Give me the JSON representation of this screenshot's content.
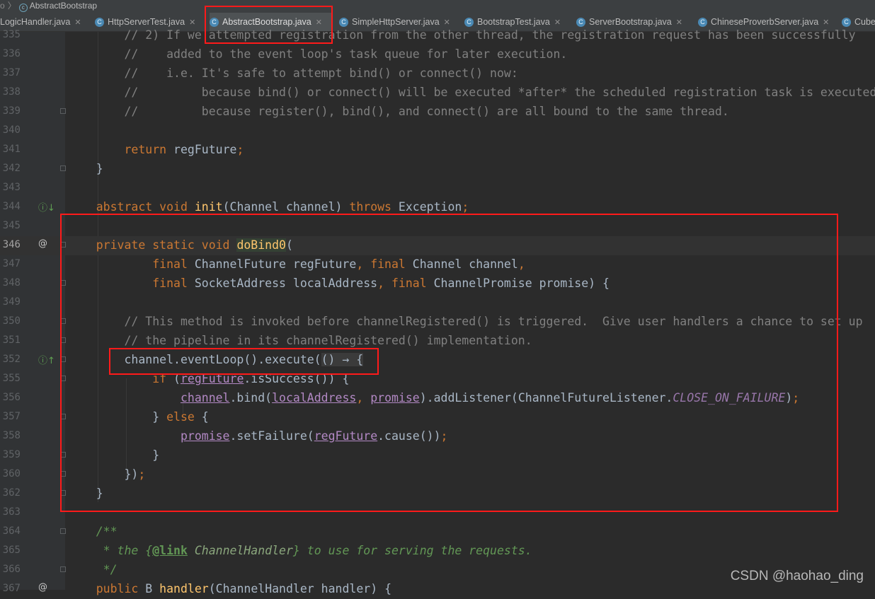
{
  "breadcrumb": {
    "prefix": "o",
    "file": "AbstractBootstrap"
  },
  "tabs": [
    {
      "label": "LogicHandler.java",
      "active": false
    },
    {
      "label": "HttpServerTest.java",
      "active": false
    },
    {
      "label": "AbstractBootstrap.java",
      "active": true
    },
    {
      "label": "SimpleHttpServer.java",
      "active": false
    },
    {
      "label": "BootstrapTest.java",
      "active": false
    },
    {
      "label": "ServerBootstrap.java",
      "active": false
    },
    {
      "label": "ChineseProverbServer.java",
      "active": false
    },
    {
      "label": "Cube",
      "active": false
    }
  ],
  "code_lines": [
    {
      "num": "335",
      "html": "        <span class=\"cm\">// 2) If we attempted registration from the other thread, the registration request has been successfully</span>"
    },
    {
      "num": "336",
      "html": "        <span class=\"cm\">//    added to the event loop's task queue for later execution.</span>"
    },
    {
      "num": "337",
      "html": "        <span class=\"cm\">//    i.e. It's safe to attempt bind() or connect() now:</span>"
    },
    {
      "num": "338",
      "html": "        <span class=\"cm\">//         because bind() or connect() will be executed *after* the scheduled registration task is executed</span>"
    },
    {
      "num": "339",
      "html": "        <span class=\"cm\">//         because register(), bind(), and connect() are all bound to the same thread.</span>",
      "fold": true
    },
    {
      "num": "340",
      "html": ""
    },
    {
      "num": "341",
      "html": "        <span class=\"kw\">return</span> regFuture<span class=\"kw\">;</span>"
    },
    {
      "num": "342",
      "html": "    }",
      "fold": true
    },
    {
      "num": "343",
      "html": ""
    },
    {
      "num": "344",
      "html": "    <span class=\"kw\">abstract void</span> <span class=\"fn\">init</span>(Channel channel) <span class=\"kw\">throws</span> Exception<span class=\"kw\">;</span>",
      "gutter_icon": "ⓘ↓",
      "gutter_icon_name": "implemented-down-icon"
    },
    {
      "num": "345",
      "html": ""
    },
    {
      "num": "346",
      "html": "    <span class=\"kw\">private static void</span> <span class=\"fn-hl\">doBind0</span>(",
      "gutter_icon": "@",
      "gutter_icon_name": "annotation-icon",
      "current": true,
      "fold": true
    },
    {
      "num": "347",
      "html": "            <span class=\"kw\">final</span> ChannelFuture regFuture<span class=\"kw\">,</span> <span class=\"kw\">final</span> Channel channel<span class=\"kw\">,</span>"
    },
    {
      "num": "348",
      "html": "            <span class=\"kw\">final</span> SocketAddress localAddress<span class=\"kw\">,</span> <span class=\"kw\">final</span> ChannelPromise promise) {",
      "fold": true
    },
    {
      "num": "349",
      "html": ""
    },
    {
      "num": "350",
      "html": "        <span class=\"cm\">// This method is invoked before channelRegistered() is triggered.  Give user handlers a chance to set up</span>",
      "fold": true
    },
    {
      "num": "351",
      "html": "        <span class=\"cm\">// the pipeline in its channelRegistered() implementation.</span>",
      "fold": true
    },
    {
      "num": "352",
      "html": "        channel.eventLoop().execute(<span class=\"fold-hint\">() → {</span>",
      "gutter_icon": "ⓘ↑",
      "gutter_icon_name": "implements-up-icon",
      "fold": true
    },
    {
      "num": "355",
      "html": "            <span class=\"kw\">if</span> (<span class=\"capt\">regFuture</span>.isSuccess()) {",
      "fold": true
    },
    {
      "num": "356",
      "html": "                <span class=\"capt\">channel</span>.bind(<span class=\"capt\">localAddress</span><span class=\"kw\">,</span> <span class=\"capt\">promise</span>).addListener(ChannelFutureListener.<span class=\"const\">CLOSE_ON_FAILURE</span>)<span class=\"kw\">;</span>"
    },
    {
      "num": "357",
      "html": "            } <span class=\"kw\">else</span> {",
      "fold": true
    },
    {
      "num": "358",
      "html": "                <span class=\"capt\">promise</span>.setFailure(<span class=\"capt\">regFuture</span>.cause())<span class=\"kw\">;</span>"
    },
    {
      "num": "359",
      "html": "            }",
      "fold": true
    },
    {
      "num": "360",
      "html": "        })<span class=\"kw\">;</span>",
      "fold": true
    },
    {
      "num": "362",
      "html": "    }",
      "fold": true
    },
    {
      "num": "363",
      "html": ""
    },
    {
      "num": "364",
      "html": "    <span class=\"doc\">/**</span>",
      "fold": true
    },
    {
      "num": "365",
      "html": "     <span class=\"doc\">* the {</span><span class=\"doc-tag\">@link</span> <span class=\"doc-ref\">ChannelHandler</span><span class=\"doc\">} to use for serving the requests.</span>"
    },
    {
      "num": "366",
      "html": "     <span class=\"doc\">*/</span>",
      "fold": true
    },
    {
      "num": "367",
      "html": "    <span class=\"kw\">public</span> B <span class=\"fn\">handler</span>(ChannelHandler handler) {",
      "gutter_icon": "@",
      "gutter_icon_name": "annotation-icon"
    }
  ],
  "watermark": "CSDN @haohao_ding"
}
